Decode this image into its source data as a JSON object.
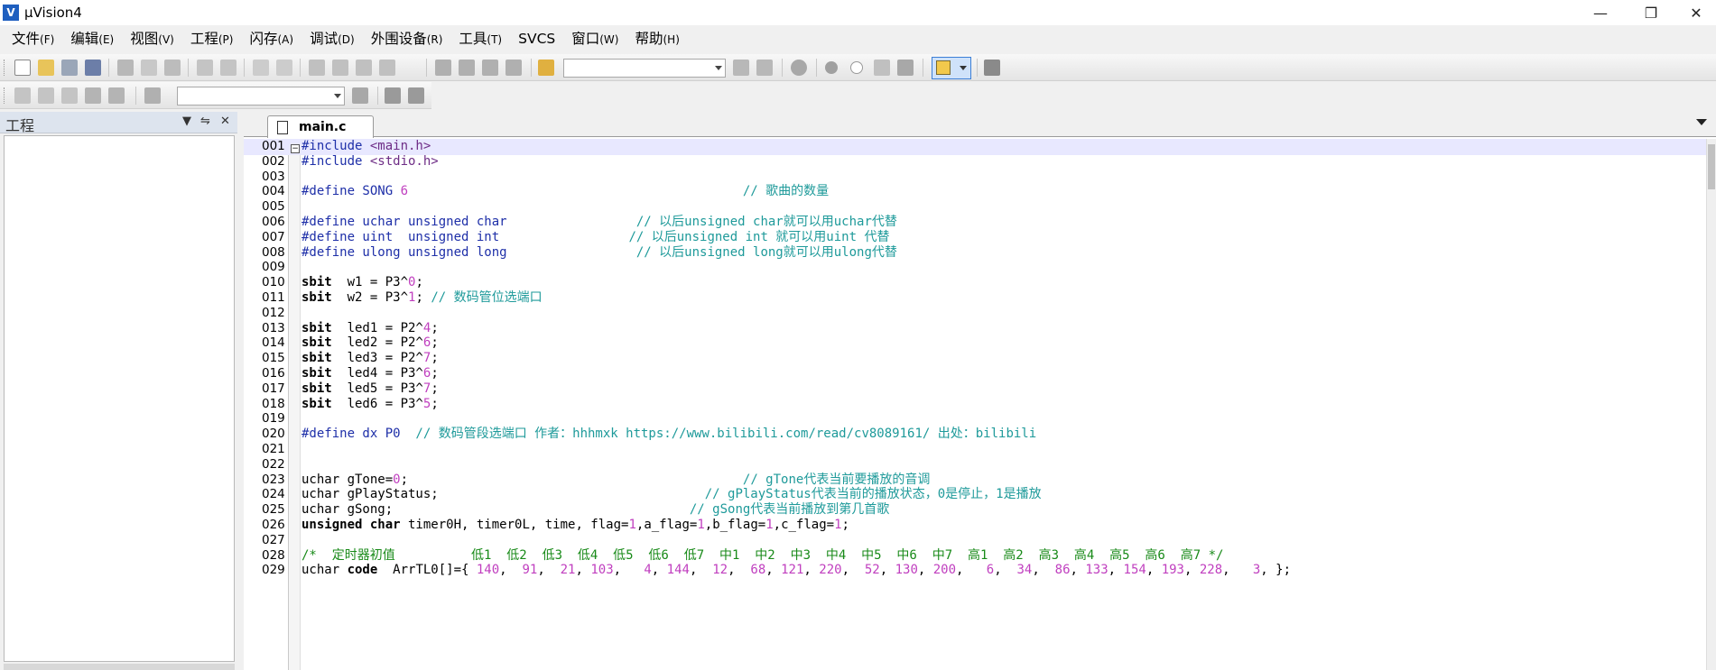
{
  "window": {
    "title": "µVision4",
    "logo": "V"
  },
  "menu": [
    {
      "label": "文件",
      "acc": "(F)"
    },
    {
      "label": "编辑",
      "acc": "(E)"
    },
    {
      "label": "视图",
      "acc": "(V)"
    },
    {
      "label": "工程",
      "acc": "(P)"
    },
    {
      "label": "闪存",
      "acc": "(A)"
    },
    {
      "label": "调试",
      "acc": "(D)"
    },
    {
      "label": "外围设备",
      "acc": "(R)"
    },
    {
      "label": "工具",
      "acc": "(T)"
    },
    {
      "label": "SVCS",
      "acc": ""
    },
    {
      "label": "窗口",
      "acc": "(W)"
    },
    {
      "label": "帮助",
      "acc": "(H)"
    }
  ],
  "project_pane": {
    "title": "工程"
  },
  "editor": {
    "tab_label": "main.c",
    "lines": [
      {
        "n": "001",
        "current": true,
        "segs": [
          [
            "pp",
            "#include "
          ],
          [
            "str",
            "<main.h>"
          ]
        ]
      },
      {
        "n": "002",
        "segs": [
          [
            "pp",
            "#include "
          ],
          [
            "str",
            "<stdio.h>"
          ]
        ]
      },
      {
        "n": "003",
        "segs": []
      },
      {
        "n": "004",
        "segs": [
          [
            "pp",
            "#define SONG "
          ],
          [
            "num",
            "6"
          ],
          [
            "cm",
            "                                            // 歌曲的数量"
          ]
        ]
      },
      {
        "n": "005",
        "segs": []
      },
      {
        "n": "006",
        "segs": [
          [
            "pp",
            "#define uchar unsigned char"
          ],
          [
            "cm",
            "                 // 以后unsigned char就可以用uchar代替"
          ]
        ]
      },
      {
        "n": "007",
        "segs": [
          [
            "pp",
            "#define uint  unsigned int"
          ],
          [
            "cm",
            "                 // 以后unsigned int 就可以用uint 代替"
          ]
        ]
      },
      {
        "n": "008",
        "segs": [
          [
            "pp",
            "#define ulong unsigned long"
          ],
          [
            "cm",
            "                 // 以后unsigned long就可以用ulong代替"
          ]
        ]
      },
      {
        "n": "009",
        "segs": []
      },
      {
        "n": "010",
        "segs": [
          [
            "kw",
            "sbit"
          ],
          [
            "",
            "  w1 = P3^"
          ],
          [
            "num",
            "0"
          ],
          [
            "",
            ";"
          ]
        ]
      },
      {
        "n": "011",
        "segs": [
          [
            "kw",
            "sbit"
          ],
          [
            "",
            "  w2 = P3^"
          ],
          [
            "num",
            "1"
          ],
          [
            "",
            "; "
          ],
          [
            "cm",
            "// 数码管位选端口"
          ]
        ]
      },
      {
        "n": "012",
        "segs": []
      },
      {
        "n": "013",
        "segs": [
          [
            "kw",
            "sbit"
          ],
          [
            "",
            "  led1 = P2^"
          ],
          [
            "num",
            "4"
          ],
          [
            "",
            ";"
          ]
        ]
      },
      {
        "n": "014",
        "segs": [
          [
            "kw",
            "sbit"
          ],
          [
            "",
            "  led2 = P2^"
          ],
          [
            "num",
            "6"
          ],
          [
            "",
            ";"
          ]
        ]
      },
      {
        "n": "015",
        "segs": [
          [
            "kw",
            "sbit"
          ],
          [
            "",
            "  led3 = P2^"
          ],
          [
            "num",
            "7"
          ],
          [
            "",
            ";"
          ]
        ]
      },
      {
        "n": "016",
        "segs": [
          [
            "kw",
            "sbit"
          ],
          [
            "",
            "  led4 = P3^"
          ],
          [
            "num",
            "6"
          ],
          [
            "",
            ";"
          ]
        ]
      },
      {
        "n": "017",
        "segs": [
          [
            "kw",
            "sbit"
          ],
          [
            "",
            "  led5 = P3^"
          ],
          [
            "num",
            "7"
          ],
          [
            "",
            ";"
          ]
        ]
      },
      {
        "n": "018",
        "segs": [
          [
            "kw",
            "sbit"
          ],
          [
            "",
            "  led6 = P3^"
          ],
          [
            "num",
            "5"
          ],
          [
            "",
            ";"
          ]
        ]
      },
      {
        "n": "019",
        "segs": []
      },
      {
        "n": "020",
        "segs": [
          [
            "pp",
            "#define dx P0"
          ],
          [
            "cm",
            "  // 数码管段选端口 作者：hhhmxk https://www.bilibili.com/read/cv8089161/ 出处：bilibili"
          ]
        ]
      },
      {
        "n": "021",
        "segs": []
      },
      {
        "n": "022",
        "segs": []
      },
      {
        "n": "023",
        "segs": [
          [
            "",
            "uchar gTone="
          ],
          [
            "num",
            "0"
          ],
          [
            "",
            ";"
          ],
          [
            "cm",
            "                                            // gTone代表当前要播放的音调"
          ]
        ]
      },
      {
        "n": "024",
        "segs": [
          [
            "",
            "uchar gPlayStatus;"
          ],
          [
            "cm",
            "                                   // gPlayStatus代表当前的播放状态，0是停止，1是播放"
          ]
        ]
      },
      {
        "n": "025",
        "segs": [
          [
            "",
            "uchar gSong;"
          ],
          [
            "cm",
            "                                       // gSong代表当前播放到第几首歌"
          ]
        ]
      },
      {
        "n": "026",
        "segs": [
          [
            "kw",
            "unsigned char"
          ],
          [
            "",
            ""
          ],
          [
            "",
            " timer0H, timer0L, time, flag="
          ],
          [
            "num",
            "1"
          ],
          [
            "",
            ",a_flag="
          ],
          [
            "num",
            "1"
          ],
          [
            "",
            ",b_flag="
          ],
          [
            "num",
            "1"
          ],
          [
            "",
            ",c_flag="
          ],
          [
            "num",
            "1"
          ],
          [
            "",
            ";"
          ]
        ]
      },
      {
        "n": "027",
        "segs": []
      },
      {
        "n": "028",
        "segs": [
          [
            "cmt",
            "/*  定时器初值          低1  低2  低3  低4  低5  低6  低7  中1  中2  中3  中4  中5  中6  中7  高1  高2  高3  高4  高5  高6  高7 */"
          ]
        ]
      },
      {
        "n": "029",
        "segs": [
          [
            "",
            "uchar "
          ],
          [
            "kw",
            "code"
          ],
          [
            "",
            "  ArrTL0[]={ "
          ],
          [
            "num",
            "140"
          ],
          [
            "",
            ",  "
          ],
          [
            "num",
            "91"
          ],
          [
            "",
            ",  "
          ],
          [
            "num",
            "21"
          ],
          [
            "",
            ", "
          ],
          [
            "num",
            "103"
          ],
          [
            "",
            ",   "
          ],
          [
            "num",
            "4"
          ],
          [
            "",
            ", "
          ],
          [
            "num",
            "144"
          ],
          [
            "",
            ",  "
          ],
          [
            "num",
            "12"
          ],
          [
            "",
            ",  "
          ],
          [
            "num",
            "68"
          ],
          [
            "",
            ", "
          ],
          [
            "num",
            "121"
          ],
          [
            "",
            ", "
          ],
          [
            "num",
            "220"
          ],
          [
            "",
            ",  "
          ],
          [
            "num",
            "52"
          ],
          [
            "",
            ", "
          ],
          [
            "num",
            "130"
          ],
          [
            "",
            ", "
          ],
          [
            "num",
            "200"
          ],
          [
            "",
            ",   "
          ],
          [
            "num",
            "6"
          ],
          [
            "",
            ",  "
          ],
          [
            "num",
            "34"
          ],
          [
            "",
            ",  "
          ],
          [
            "num",
            "86"
          ],
          [
            "",
            ", "
          ],
          [
            "num",
            "133"
          ],
          [
            "",
            ", "
          ],
          [
            "num",
            "154"
          ],
          [
            "",
            ", "
          ],
          [
            "num",
            "193"
          ],
          [
            "",
            ", "
          ],
          [
            "num",
            "228"
          ],
          [
            "",
            ",   "
          ],
          [
            "num",
            "3"
          ],
          [
            "",
            ", };"
          ]
        ]
      }
    ]
  }
}
